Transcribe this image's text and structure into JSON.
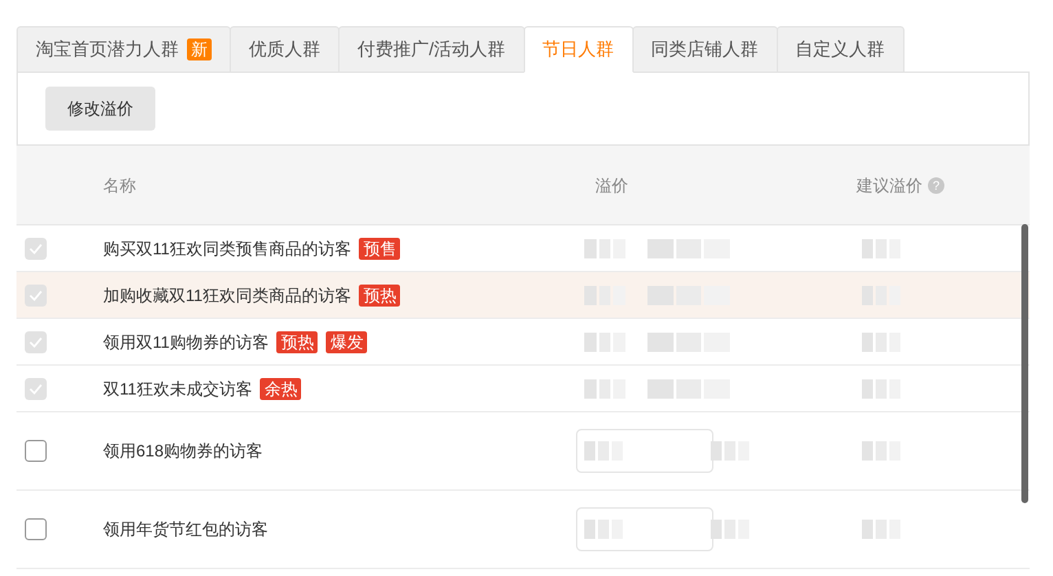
{
  "tabs": [
    {
      "label": "淘宝首页潜力人群",
      "badge": "新",
      "selected": false
    },
    {
      "label": "优质人群",
      "selected": false
    },
    {
      "label": "付费推广/活动人群",
      "selected": false
    },
    {
      "label": "节日人群",
      "selected": true
    },
    {
      "label": "同类店铺人群",
      "selected": false
    },
    {
      "label": "自定义人群",
      "selected": false
    }
  ],
  "toolbar": {
    "button": "修改溢价"
  },
  "table": {
    "columns": [
      {
        "label": "名称"
      },
      {
        "label": "溢价"
      },
      {
        "label": "建议溢价",
        "help": "?"
      }
    ],
    "rows": [
      {
        "name": "购买双11狂欢同类预售商品的访客",
        "tags": [
          "预售"
        ],
        "checked": true,
        "disabled": true,
        "selected": false,
        "kind": "text"
      },
      {
        "name": "加购收藏双11狂欢同类商品的访客",
        "tags": [
          "预热"
        ],
        "checked": true,
        "disabled": true,
        "selected": true,
        "kind": "text"
      },
      {
        "name": "领用双11购物券的访客",
        "tags": [
          "预热",
          "爆发"
        ],
        "checked": true,
        "disabled": true,
        "selected": false,
        "kind": "text"
      },
      {
        "name": "双11狂欢未成交访客",
        "tags": [
          "余热"
        ],
        "checked": true,
        "disabled": true,
        "selected": false,
        "kind": "text"
      },
      {
        "name": "领用618购物券的访客",
        "checked": false,
        "disabled": false,
        "selected": false,
        "kind": "input"
      },
      {
        "name": "领用年货节红包的访客",
        "checked": false,
        "disabled": false,
        "selected": false,
        "kind": "input"
      }
    ]
  }
}
